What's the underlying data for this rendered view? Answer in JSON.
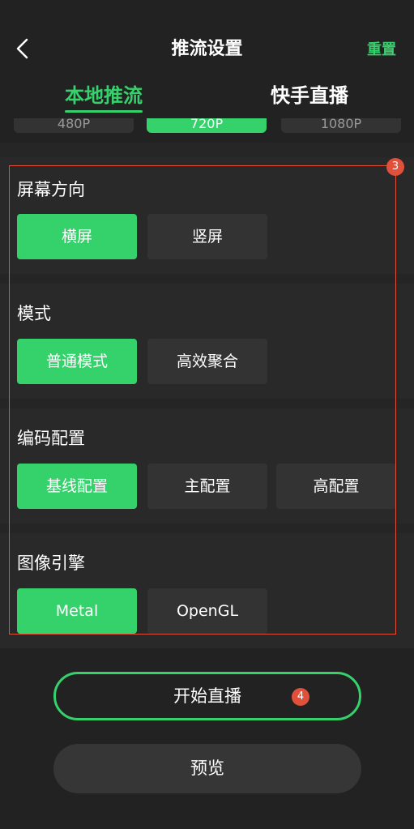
{
  "header": {
    "title": "推流设置",
    "reset_label": "重置",
    "back_icon": "chevron-left-icon"
  },
  "tabs": [
    {
      "label": "本地推流",
      "active": true
    },
    {
      "label": "快手直播",
      "active": false
    }
  ],
  "resolution": {
    "options": [
      "480P",
      "720P",
      "1080P"
    ],
    "selected": "720P"
  },
  "sections": {
    "orientation": {
      "title": "屏幕方向",
      "options": [
        "横屏",
        "竖屏"
      ],
      "selected": "横屏"
    },
    "mode": {
      "title": "模式",
      "options": [
        "普通模式",
        "高效聚合"
      ],
      "selected": "普通模式"
    },
    "encoding": {
      "title": "编码配置",
      "options": [
        "基线配置",
        "主配置",
        "高配置"
      ],
      "selected": "基线配置"
    },
    "engine": {
      "title": "图像引擎",
      "options": [
        "Metal",
        "OpenGL"
      ],
      "selected": "Metal"
    }
  },
  "annotations": {
    "badge_3": "3",
    "badge_4": "4"
  },
  "actions": {
    "start_label": "开始直播",
    "preview_label": "预览"
  },
  "colors": {
    "accent": "#35d26c",
    "annotation": "#e0503a",
    "background": "#222222"
  }
}
